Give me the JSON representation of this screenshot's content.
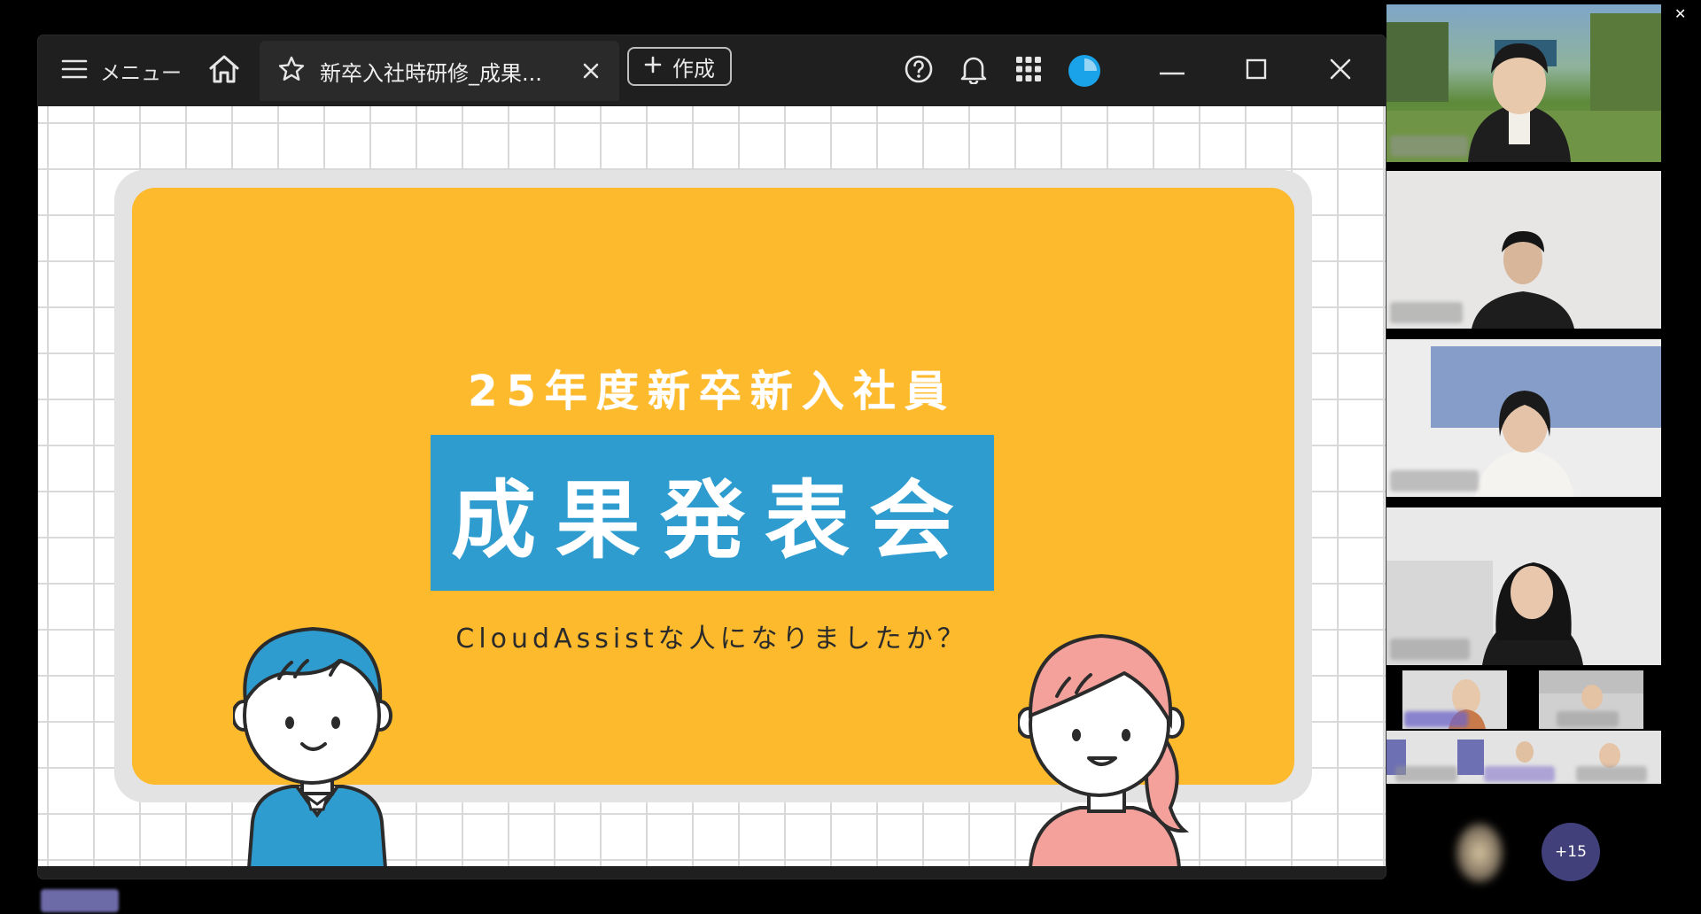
{
  "toolbar": {
    "menu_label": "メニュー",
    "tab_title": "新卒入社時研修_成果...",
    "create_label": "作成",
    "brand_color": "#1aa3e8"
  },
  "slide": {
    "subtitle": "25年度新卒新入社員",
    "title": "成果発表会",
    "tagline": "CloudAssistな人になりましたか？",
    "colors": {
      "board": "#fdba2c",
      "title_box": "#2f9cd0",
      "boy": "#2f9cd0",
      "girl": "#f4a19b"
    }
  },
  "participants": {
    "more_count": "+15"
  },
  "icons": {
    "menu": "hamburger-icon",
    "home": "home-icon",
    "favorite": "star-icon",
    "close_tab": "close-icon",
    "create": "plus-icon",
    "help": "help-icon",
    "notifications": "bell-icon",
    "apps": "grid-icon",
    "minimize": "minimize-icon",
    "maximize": "maximize-icon",
    "close_window": "close-icon"
  }
}
